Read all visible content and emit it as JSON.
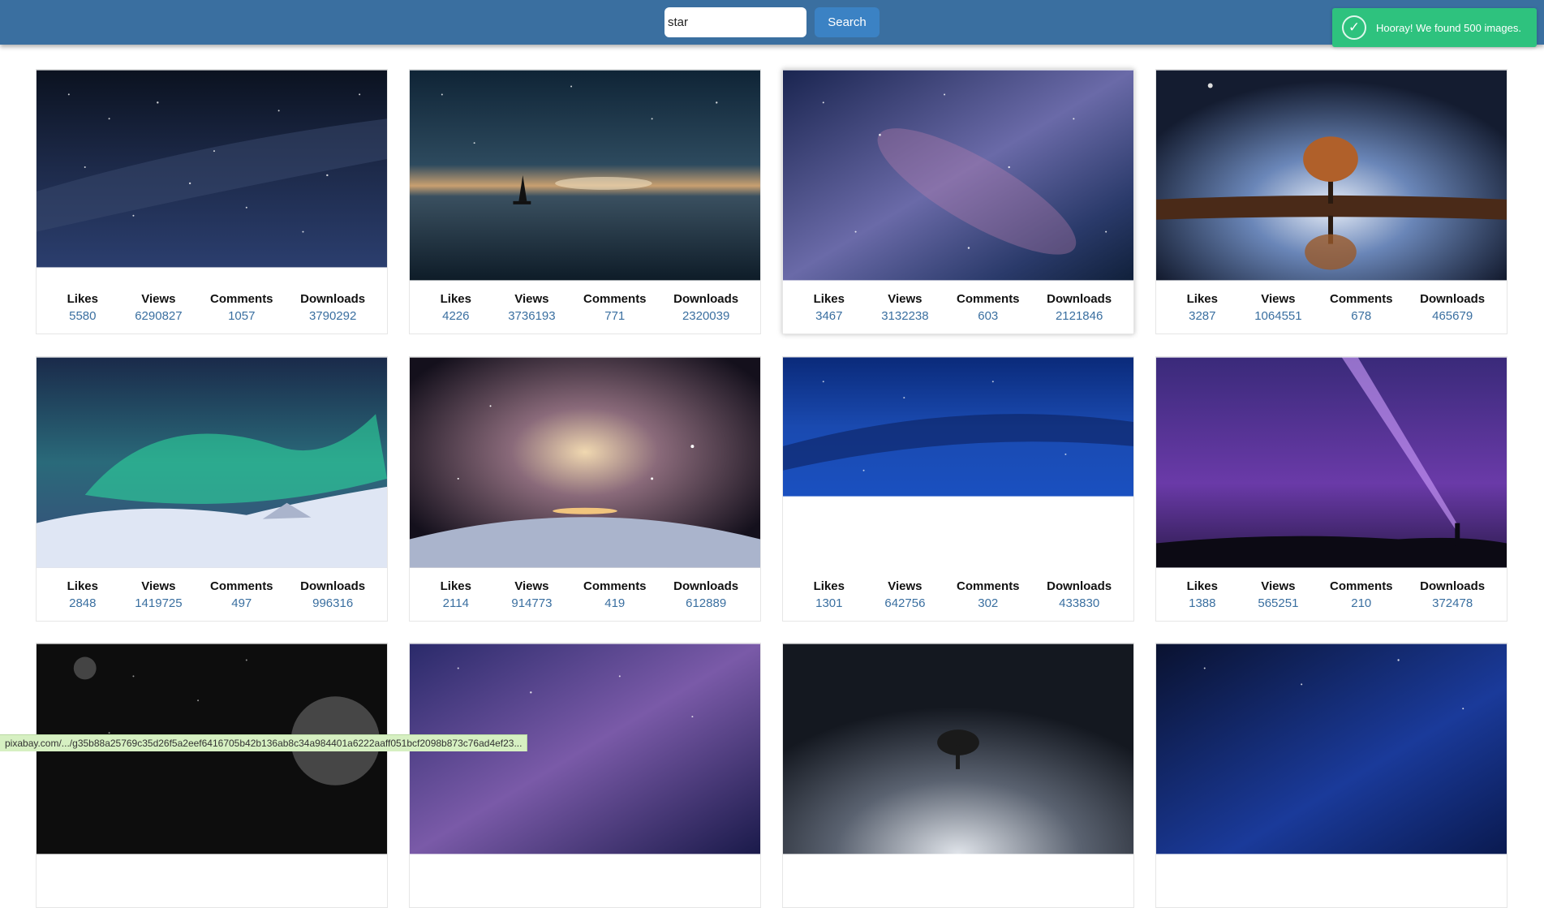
{
  "search": {
    "value": "star",
    "button_label": "Search"
  },
  "toast": {
    "message": "Hooray! We found 500 images.",
    "color": "#2ec27e",
    "icon": "check-circle-icon"
  },
  "stat_labels": {
    "likes": "Likes",
    "views": "Views",
    "comments": "Comments",
    "downloads": "Downloads"
  },
  "images": [
    {
      "likes": "5580",
      "views": "6290827",
      "comments": "1057",
      "downloads": "3790292"
    },
    {
      "likes": "4226",
      "views": "3736193",
      "comments": "771",
      "downloads": "2320039"
    },
    {
      "likes": "3467",
      "views": "3132238",
      "comments": "603",
      "downloads": "2121846"
    },
    {
      "likes": "3287",
      "views": "1064551",
      "comments": "678",
      "downloads": "465679"
    },
    {
      "likes": "2848",
      "views": "1419725",
      "comments": "497",
      "downloads": "996316"
    },
    {
      "likes": "2114",
      "views": "914773",
      "comments": "419",
      "downloads": "612889"
    },
    {
      "likes": "1301",
      "views": "642756",
      "comments": "302",
      "downloads": "433830"
    },
    {
      "likes": "1388",
      "views": "565251",
      "comments": "210",
      "downloads": "372478"
    }
  ],
  "status_bar": {
    "url": "pixabay.com/.../g35b88a25769c35d26f5a2eef6416705b42b136ab8c34a984401a6222aaff051bcf2098b873c76ad4ef23..."
  },
  "colors": {
    "header": "#3a6fa0",
    "accent": "#3b82c4",
    "stat_value": "#3a6fa0"
  }
}
